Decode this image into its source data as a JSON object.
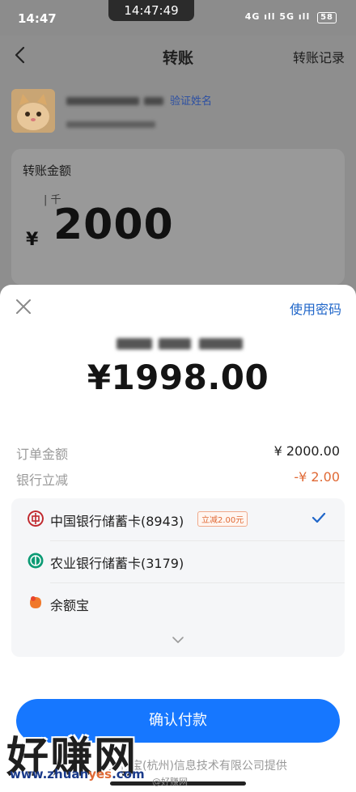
{
  "status_bar": {
    "time": "14:47",
    "center_time": "14:47:49",
    "signal_text": "4G ıll 5G ıll",
    "battery": "58"
  },
  "nav": {
    "title": "转账",
    "right_link": "转账记录"
  },
  "payee": {
    "verify_name_link": "验证姓名"
  },
  "amount_card": {
    "label": "转账金额",
    "unit_hint": "千",
    "currency": "¥",
    "value": "2000"
  },
  "sheet": {
    "use_password": "使用密码",
    "pay_amount": "¥1998.00",
    "order_label": "订单金额",
    "order_value": "¥ 2000.00",
    "discount_label": "银行立减",
    "discount_value": "-¥ 2.00",
    "cards": [
      {
        "label": "中国银行储蓄卡(8943)",
        "promo": "立减2.00元",
        "color": "#c0282d",
        "selected": true
      },
      {
        "label": "农业银行储蓄卡(3179)",
        "promo": "",
        "color": "#0d9b75",
        "selected": false
      },
      {
        "label": "余额宝",
        "promo": "",
        "color": "#f0782a",
        "selected": false
      }
    ],
    "confirm_button": "确认付款",
    "provider_text": "由支付宝(杭州)信息技术有限公司提供"
  },
  "watermark": {
    "main": "好赚网",
    "url_prefix": "www.zhuan",
    "url_accent": "yes",
    "url_suffix": ".com",
    "weibo": "@好赚网"
  },
  "colors": {
    "accent": "#1677ff",
    "link": "#1f66c9",
    "discount": "#e06a36"
  }
}
